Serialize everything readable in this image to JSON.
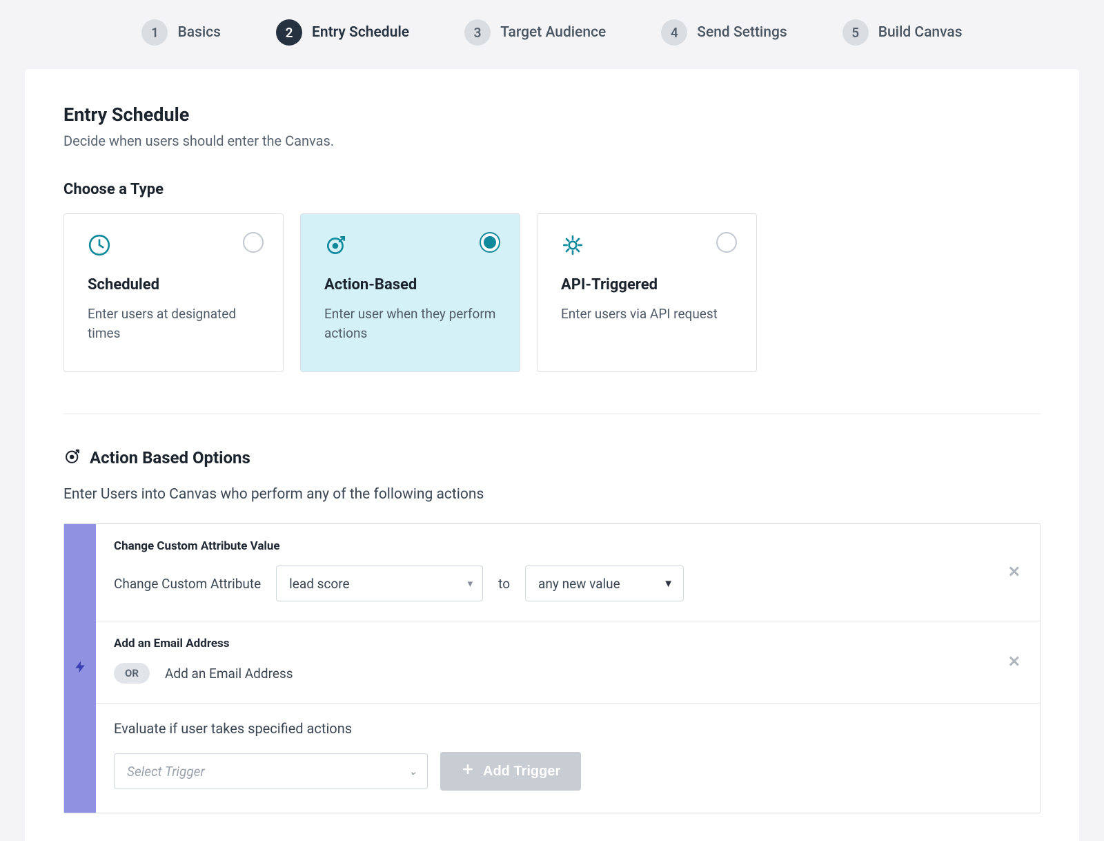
{
  "stepper": {
    "steps": [
      {
        "num": "1",
        "label": "Basics"
      },
      {
        "num": "2",
        "label": "Entry Schedule"
      },
      {
        "num": "3",
        "label": "Target Audience"
      },
      {
        "num": "4",
        "label": "Send Settings"
      },
      {
        "num": "5",
        "label": "Build Canvas"
      }
    ],
    "active_index": 1
  },
  "page": {
    "title": "Entry Schedule",
    "subtitle": "Decide when users should enter the Canvas."
  },
  "choose_type": {
    "heading": "Choose a Type",
    "cards": [
      {
        "title": "Scheduled",
        "desc": "Enter users at designated times",
        "icon": "clock"
      },
      {
        "title": "Action-Based",
        "desc": "Enter user when they perform actions",
        "icon": "target"
      },
      {
        "title": "API-Triggered",
        "desc": "Enter users via API request",
        "icon": "gear"
      }
    ],
    "selected_index": 1
  },
  "action_based": {
    "heading": "Action Based Options",
    "subheading": "Enter Users into Canvas who perform any of the following actions",
    "triggers": [
      {
        "title": "Change Custom Attribute Value",
        "prefix_label": "Change Custom Attribute",
        "attribute_value": "lead score",
        "joiner": "to",
        "target_value": "any new value"
      },
      {
        "title": "Add an Email Address",
        "or_label": "OR",
        "desc": "Add an Email Address"
      }
    ],
    "evaluate_label": "Evaluate if user takes specified actions",
    "select_trigger_placeholder": "Select Trigger",
    "add_trigger_label": "Add Trigger"
  }
}
